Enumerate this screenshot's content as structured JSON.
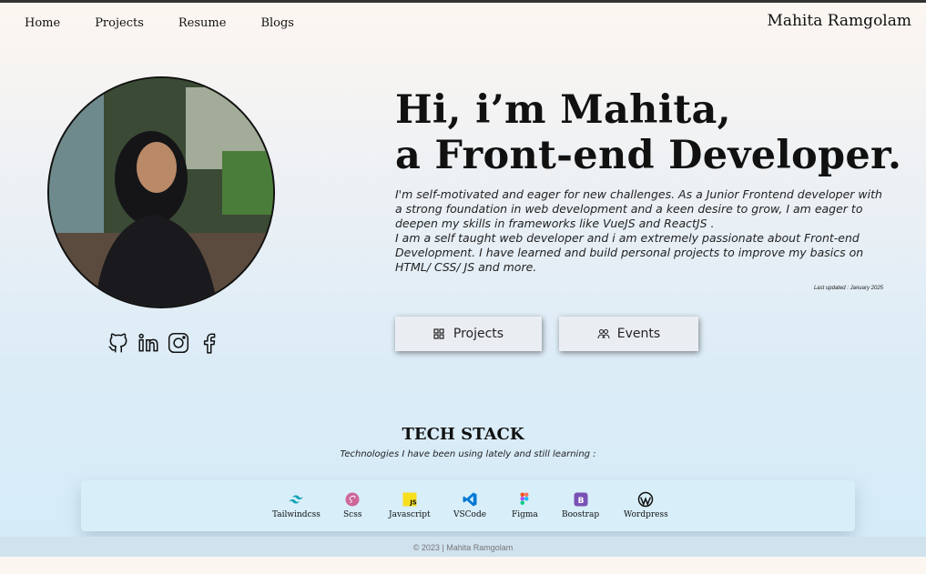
{
  "nav": {
    "items": [
      "Home",
      "Projects",
      "Resume",
      "Blogs"
    ],
    "brand": "Mahita Ramgolam"
  },
  "hero": {
    "title_line1": "Hi, i’m Mahita,",
    "title_line2": "a Front-end Developer.",
    "para1": "I'm self-motivated and eager for new challenges. As a Junior Frontend developer with a strong foundation in web development and a keen desire to grow, I am eager to deepen my skills in frameworks like VueJS and ReactJS .",
    "para2": "I am a self taught web developer and i am extremely passionate about Front-end Development. I have learned and build personal projects to improve my basics on HTML/ CSS/ JS and more.",
    "updated": "Last updated : January 2025"
  },
  "buttons": {
    "projects": "Projects",
    "events": "Events"
  },
  "socials": [
    "github-icon",
    "linkedin-icon",
    "instagram-icon",
    "facebook-icon"
  ],
  "tech": {
    "title": "TECH STACK",
    "subtitle": "Technologies I have been using lately and still learning :",
    "items": [
      "Tailwindcss",
      "Scss",
      "Javascript",
      "VSCode",
      "Figma",
      "Boostrap",
      "Wordpress"
    ]
  },
  "footer": {
    "text": "© 2023 | Mahita Ramgolam"
  },
  "colors": {
    "text": "#111111",
    "tailwind": "#38bdf8",
    "scss": "#cd6799",
    "javascript": "#f7df1e",
    "vscode": "#0078d4",
    "bootstrap": "#7952b3"
  }
}
